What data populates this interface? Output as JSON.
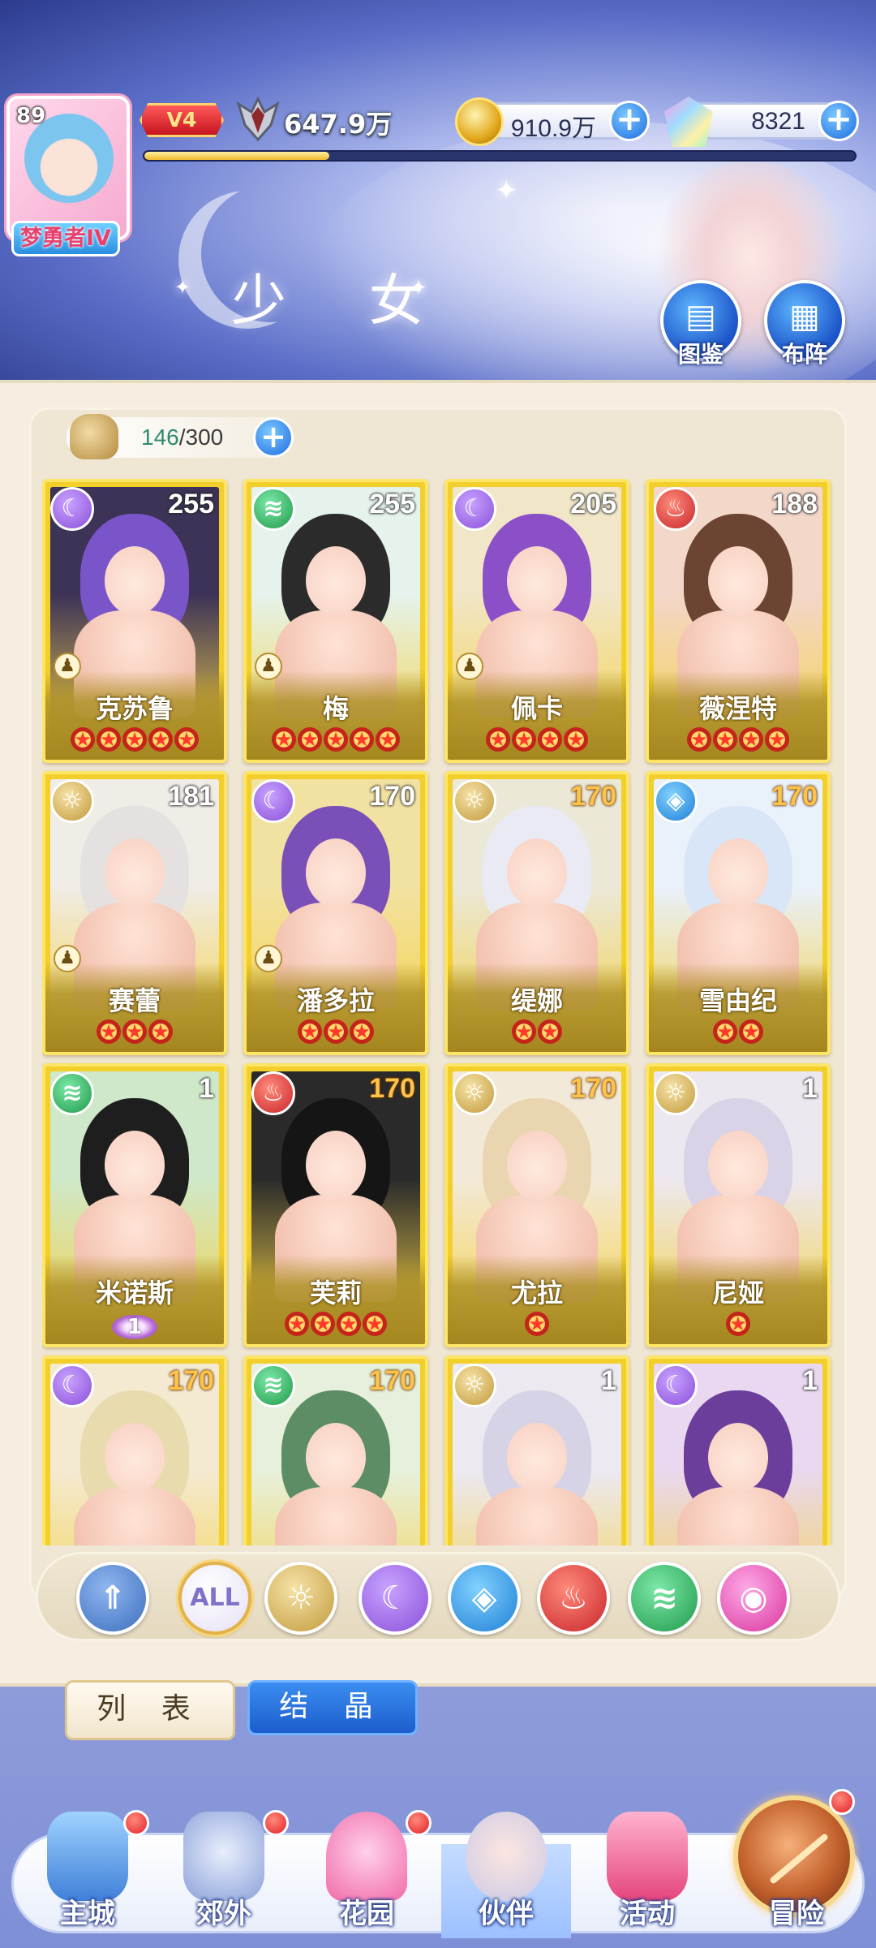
{
  "player": {
    "level": "89",
    "rank_title": "梦勇者IV",
    "vip": "V4",
    "power": "647.9万",
    "exp_progress": 0.26
  },
  "currencies": {
    "gold": "910.9万",
    "gems": "8321"
  },
  "header": {
    "title": "少 女",
    "codex_label": "图鉴",
    "formation_label": "布阵"
  },
  "capacity": {
    "current": "146",
    "sep_max": "/300"
  },
  "cards": [
    {
      "name": "克苏鲁",
      "level": "255",
      "element": "moon-icon",
      "stars": 5,
      "pawn": true
    },
    {
      "name": "梅",
      "level": "255",
      "element": "wind-icon",
      "stars": 5,
      "pawn": true
    },
    {
      "name": "佩卡",
      "level": "205",
      "element": "moon-icon",
      "stars": 4,
      "pawn": true
    },
    {
      "name": "薇涅特",
      "level": "188",
      "element": "fire-icon",
      "stars": 4,
      "pawn": false
    },
    {
      "name": "赛蕾",
      "level": "181",
      "element": "sun-icon",
      "stars": 3,
      "pawn": true
    },
    {
      "name": "潘多拉",
      "level": "170",
      "element": "moon-icon",
      "stars": 3,
      "pawn": true
    },
    {
      "name": "缇娜",
      "level": "170",
      "element": "sun-icon",
      "stars": 2,
      "pawn": false
    },
    {
      "name": "雪由纪",
      "level": "170",
      "element": "water-icon",
      "stars": 2,
      "pawn": false
    },
    {
      "name": "米诺斯",
      "level": "1",
      "element": "wind-icon",
      "stars": 0,
      "awaken": "1",
      "pawn": false
    },
    {
      "name": "芙莉",
      "level": "170",
      "element": "fire-icon",
      "stars": 4,
      "pawn": false
    },
    {
      "name": "尤拉",
      "level": "170",
      "element": "sun-icon",
      "stars": 1,
      "pawn": false
    },
    {
      "name": "尼娅",
      "level": "1",
      "element": "sun-icon",
      "stars": 1,
      "pawn": false
    },
    {
      "name": "",
      "level": "170",
      "element": "moon-icon",
      "stars": 0,
      "pawn": false
    },
    {
      "name": "",
      "level": "170",
      "element": "wind-icon",
      "stars": 0,
      "pawn": false
    },
    {
      "name": "",
      "level": "1",
      "element": "sun-icon",
      "stars": 0,
      "pawn": false
    },
    {
      "name": "",
      "level": "1",
      "element": "moon-icon",
      "stars": 0,
      "pawn": false
    }
  ],
  "filters": [
    {
      "id": "star",
      "icon": "sparkle-up-icon"
    },
    {
      "id": "all",
      "label": "ALL"
    },
    {
      "id": "sun",
      "icon": "sun-icon"
    },
    {
      "id": "moon",
      "icon": "moon-icon"
    },
    {
      "id": "water",
      "icon": "water-icon"
    },
    {
      "id": "fire",
      "icon": "fire-icon"
    },
    {
      "id": "wind",
      "icon": "wind-icon"
    },
    {
      "id": "star-orb",
      "icon": "star-orb-icon"
    }
  ],
  "view_tabs": {
    "list": "列 表",
    "crystal": "结 晶"
  },
  "nav": [
    {
      "label": "主城",
      "badge": true
    },
    {
      "label": "郊外",
      "badge": true
    },
    {
      "label": "花园",
      "badge": true
    },
    {
      "label": "伙伴",
      "badge": false
    },
    {
      "label": "活动",
      "badge": false
    },
    {
      "label": "冒险",
      "badge": true
    }
  ]
}
